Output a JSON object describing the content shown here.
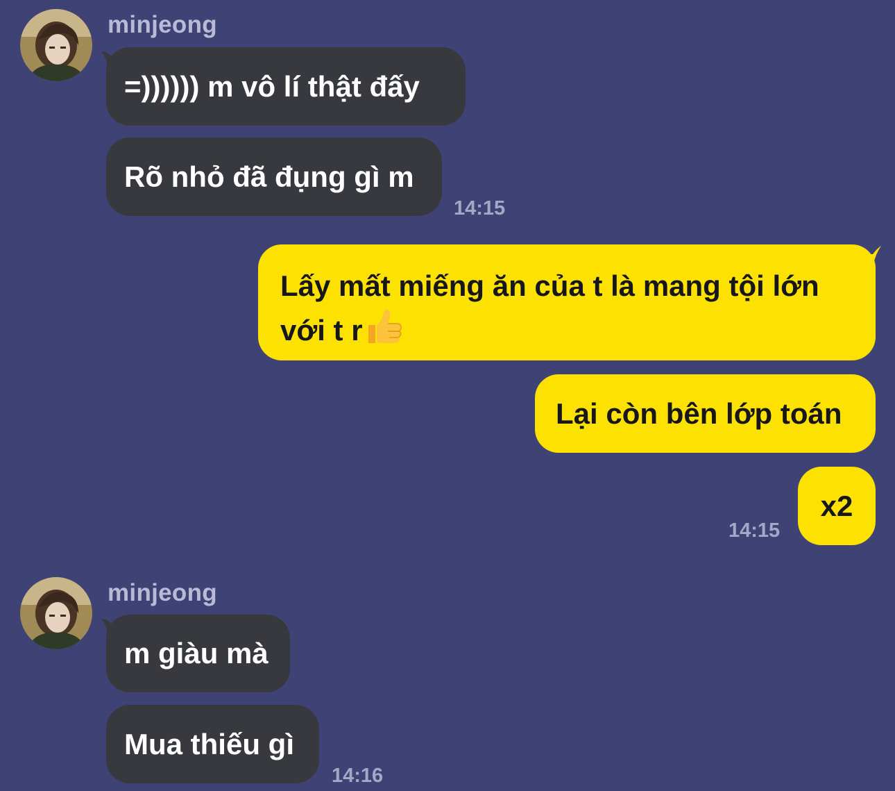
{
  "colors": {
    "background": "#3f4274",
    "incoming_bubble": "#38393e",
    "outgoing_bubble": "#fde100",
    "timestamp": "#a5a7c6",
    "sender_name": "#b9bbd6"
  },
  "groups": [
    {
      "sender": "minjeong",
      "messages": [
        "=)))))) m vô lí thật đấy",
        "Rõ nhỏ đã đụng gì m"
      ],
      "time": "14:15"
    },
    {
      "sender": "me",
      "messages": [
        "Lấy mất miếng ăn của t là mang tội lớn",
        "với t r",
        "Lại còn bên lớp toán",
        "x2"
      ],
      "emoji": "thumbs-up-emoji",
      "time": "14:15"
    },
    {
      "sender": "minjeong",
      "messages": [
        "m giàu mà",
        "Mua thiếu gì"
      ],
      "time": "14:16"
    }
  ]
}
